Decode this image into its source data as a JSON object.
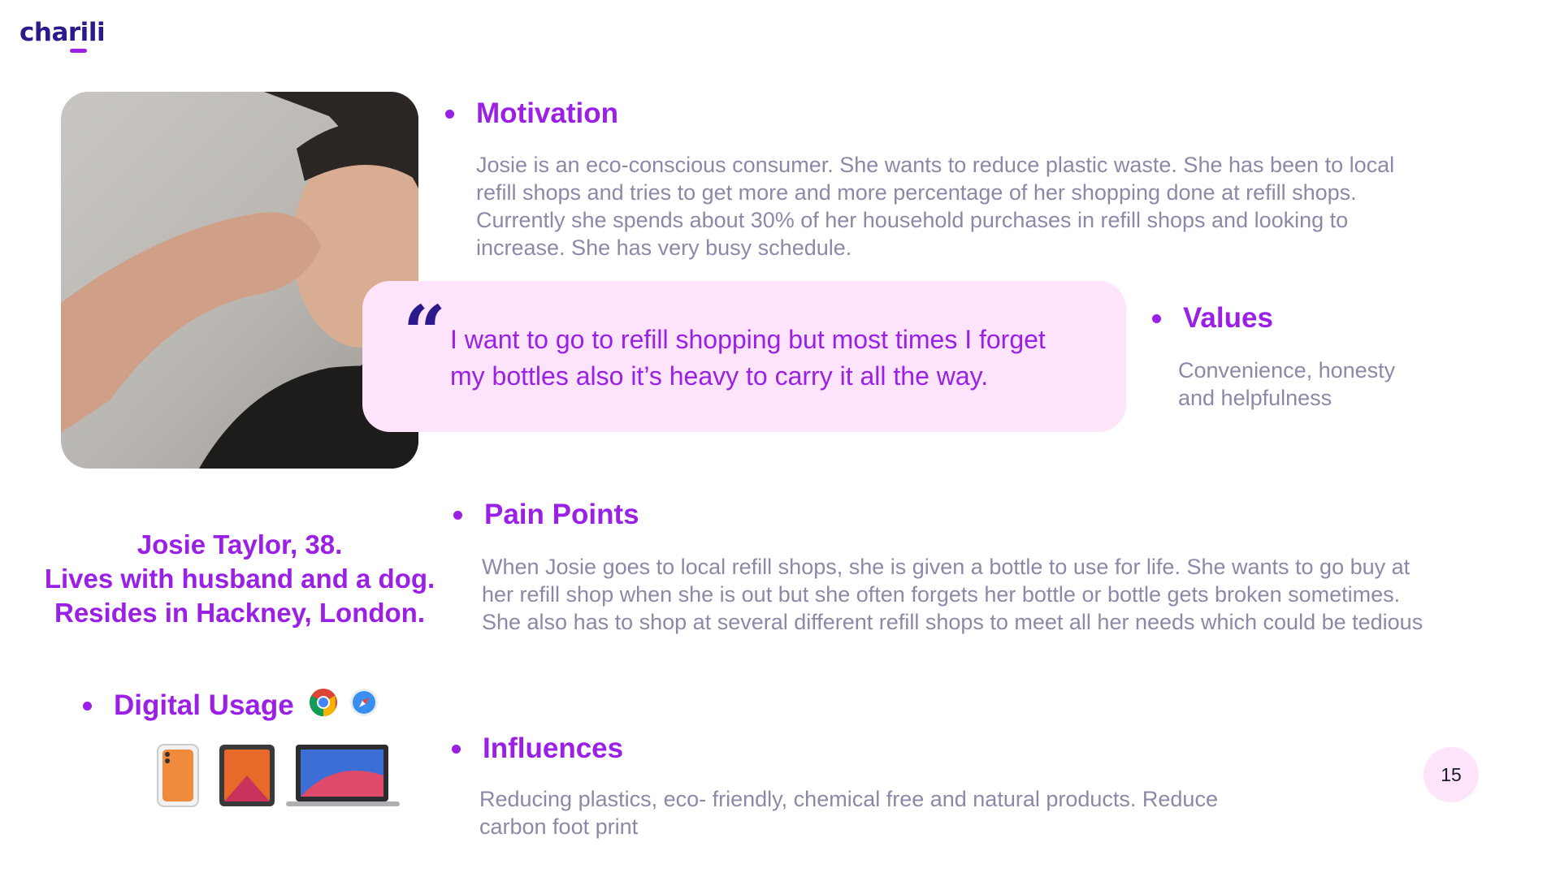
{
  "brand": {
    "logo_text_1": "cha",
    "logo_text_2": "r",
    "logo_text_3": "i",
    "logo_text_4": "li"
  },
  "motivation": {
    "title": "Motivation",
    "text": "Josie is an eco-conscious consumer. She wants to reduce plastic waste. She has been to local\nrefill shops and tries to get more and more percentage of her shopping done at refill shops.\nCurrently she spends about 30% of her household purchases in refill shops and looking to\nincrease. She has very busy schedule."
  },
  "quote": {
    "mark": "“",
    "text": "I want to go to refill shopping but most times I forget\nmy bottles also it’s heavy to carry it all the way."
  },
  "values": {
    "title": "Values",
    "text": "Convenience, honesty\nand  helpfulness"
  },
  "pain_points": {
    "title": "Pain Points",
    "text": "When Josie goes to local refill shops, she is given a bottle to use for life. She wants to go buy at\nher refill shop when she is out but she often forgets her bottle or bottle gets broken sometimes.\nShe also has to shop at several different refill shops to meet all her needs which could be tedious"
  },
  "persona": {
    "line1": "Josie Taylor, 38.",
    "line2": "Lives with husband and a dog.",
    "line3": "Resides in Hackney, London."
  },
  "digital_usage": {
    "title": "Digital Usage",
    "icons": [
      "chrome-icon",
      "safari-icon"
    ],
    "devices": [
      "iphone-icon",
      "ipad-icon",
      "macbook-icon"
    ]
  },
  "influences": {
    "title": "Influences",
    "text": "Reducing plastics, eco- friendly, chemical free and natural products. Reduce\ncarbon foot print"
  },
  "page_number": "15",
  "colors": {
    "accent": "#9b20e6",
    "logo": "#2a1a8c",
    "body_text": "#8a8aa8",
    "quote_bg": "#fde4fb"
  }
}
